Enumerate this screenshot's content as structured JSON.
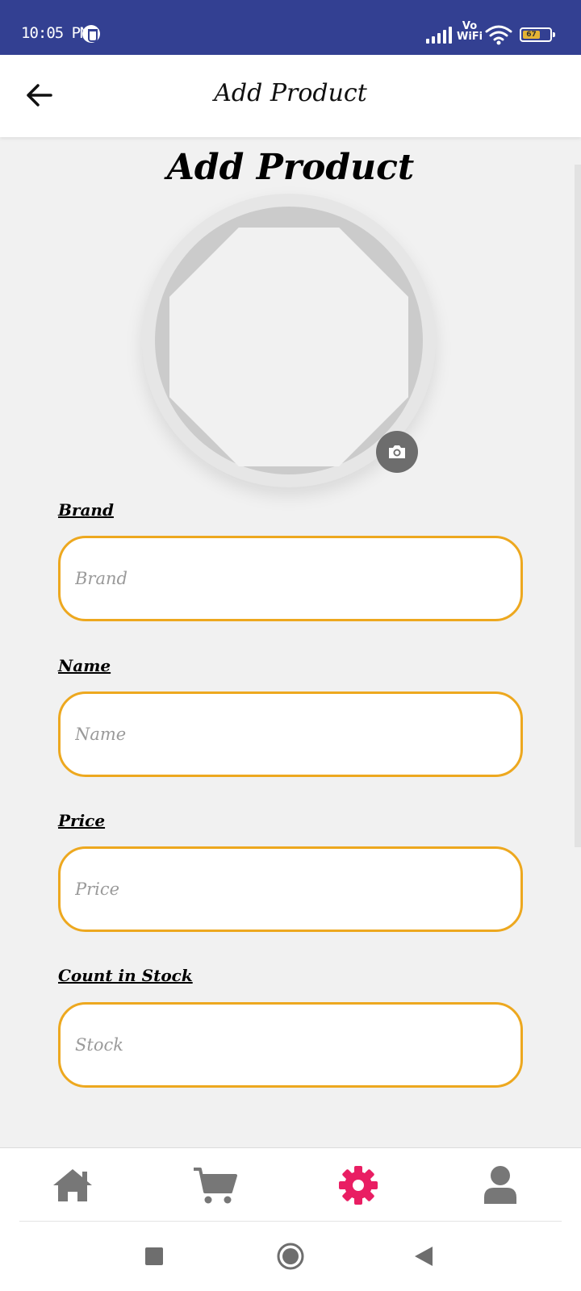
{
  "status_bar": {
    "time": "10:05 PM",
    "network_label_top": "Vo",
    "network_label_bottom": "WiFi",
    "battery_level": "67",
    "background": "#334092",
    "icons": [
      "app-notification-icon",
      "signal-icon",
      "wifi-icon",
      "battery-icon"
    ]
  },
  "app_bar": {
    "title": "Add Product",
    "back_icon": "arrow-left-icon"
  },
  "page": {
    "heading": "Add Product",
    "camera_icon": "camera-icon"
  },
  "form": {
    "accent_color": "#eda81f",
    "fields": [
      {
        "label": "Brand",
        "placeholder": "Brand",
        "value": ""
      },
      {
        "label": "Name",
        "placeholder": "Name",
        "value": ""
      },
      {
        "label": "Price",
        "placeholder": "Price",
        "value": ""
      },
      {
        "label": "Count in Stock",
        "placeholder": "Stock",
        "value": ""
      }
    ]
  },
  "bottom_nav": {
    "active_color": "#e91e63",
    "inactive_color": "#777777",
    "items": [
      {
        "icon": "home-icon",
        "active": false
      },
      {
        "icon": "cart-icon",
        "active": false
      },
      {
        "icon": "gear-icon",
        "active": true
      },
      {
        "icon": "user-icon",
        "active": false
      }
    ]
  },
  "system_nav": {
    "items": [
      "recents-square-icon",
      "home-circle-icon",
      "back-triangle-icon"
    ]
  }
}
